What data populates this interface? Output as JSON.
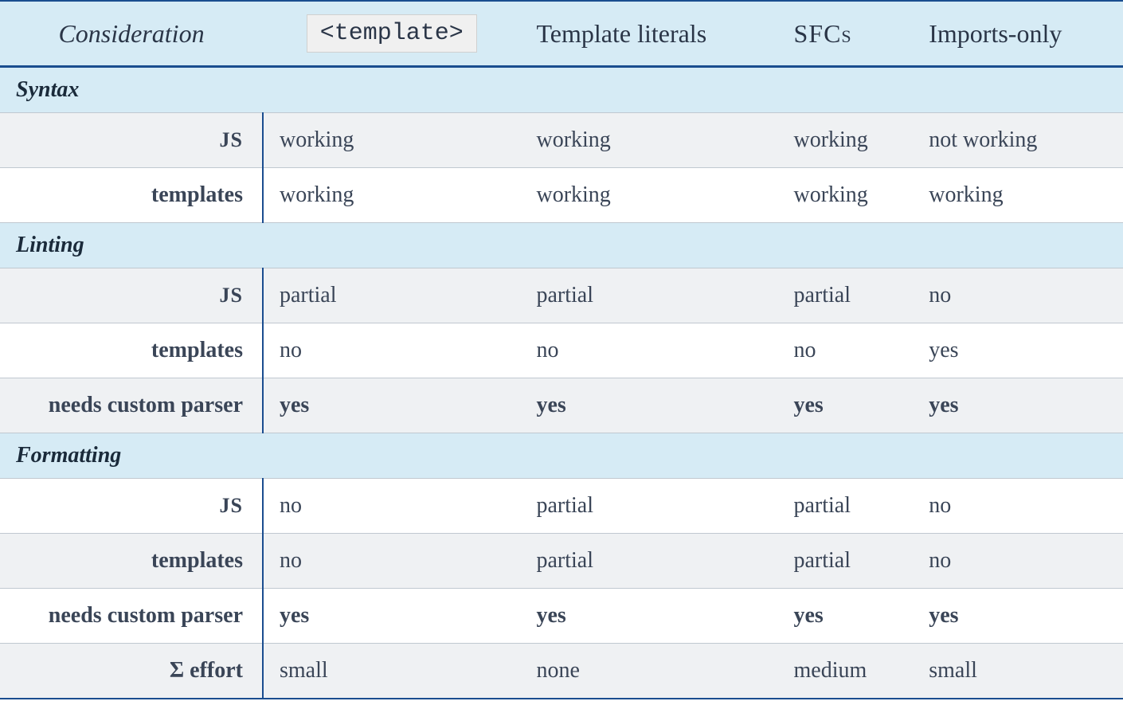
{
  "headers": {
    "consideration": "Consideration",
    "template": "<template>",
    "literals": "Template literals",
    "sfcs": "SFCs",
    "imports": "Imports-only"
  },
  "sections": [
    {
      "title": "Syntax",
      "rows": [
        {
          "label": "JS",
          "label_style": "smallcaps",
          "bold": false,
          "cells": [
            "working",
            "working",
            "working",
            "not working"
          ]
        },
        {
          "label": "templates",
          "label_style": "normal",
          "bold": false,
          "cells": [
            "working",
            "working",
            "working",
            "working"
          ]
        }
      ]
    },
    {
      "title": "Linting",
      "rows": [
        {
          "label": "JS",
          "label_style": "smallcaps",
          "bold": false,
          "cells": [
            "partial",
            "partial",
            "partial",
            "no"
          ]
        },
        {
          "label": "templates",
          "label_style": "normal",
          "bold": false,
          "cells": [
            "no",
            "no",
            "no",
            "yes"
          ]
        },
        {
          "label": "needs custom parser",
          "label_style": "normal",
          "bold": true,
          "cells": [
            "yes",
            "yes",
            "yes",
            "yes"
          ]
        }
      ]
    },
    {
      "title": "Formatting",
      "rows": [
        {
          "label": "JS",
          "label_style": "smallcaps",
          "bold": false,
          "cells": [
            "no",
            "partial",
            "partial",
            "no"
          ]
        },
        {
          "label": "templates",
          "label_style": "normal",
          "bold": false,
          "cells": [
            "no",
            "partial",
            "partial",
            "no"
          ]
        },
        {
          "label": "needs custom parser",
          "label_style": "normal",
          "bold": true,
          "cells": [
            "yes",
            "yes",
            "yes",
            "yes"
          ]
        }
      ]
    }
  ],
  "final_row": {
    "label": "Σ effort",
    "cells": [
      "small",
      "none",
      "medium",
      "small"
    ]
  }
}
